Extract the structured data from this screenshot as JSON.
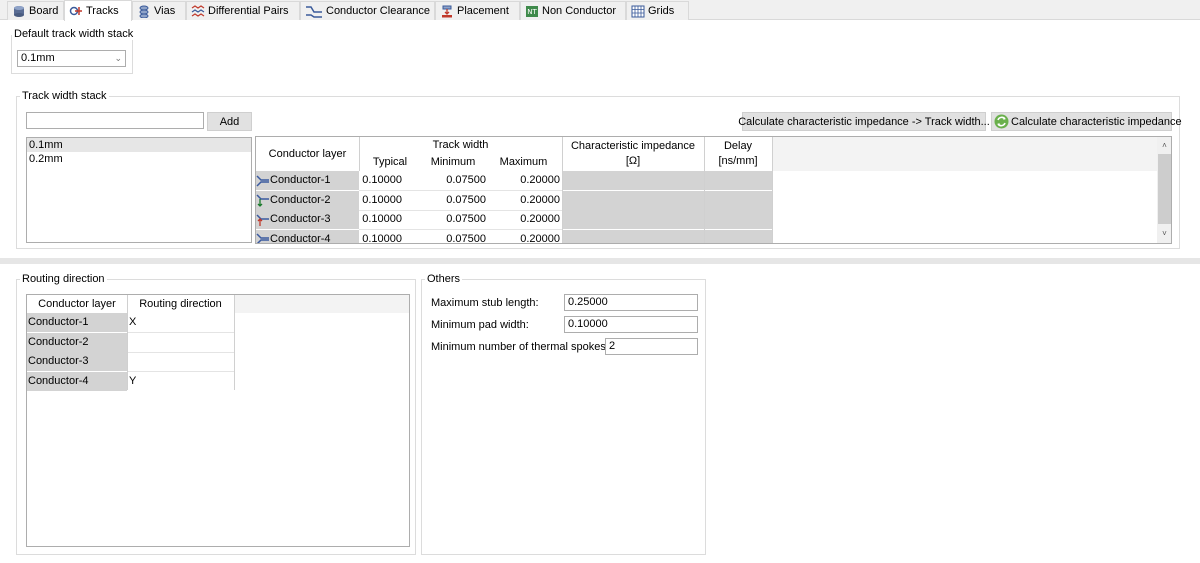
{
  "tabs": [
    {
      "label": "Board",
      "icon": "board-icon"
    },
    {
      "label": "Tracks",
      "icon": "tracks-icon",
      "active": true
    },
    {
      "label": "Vias",
      "icon": "vias-icon"
    },
    {
      "label": "Differential Pairs",
      "icon": "differential-pairs-icon"
    },
    {
      "label": "Conductor Clearance",
      "icon": "conductor-clearance-icon"
    },
    {
      "label": "Placement",
      "icon": "placement-icon"
    },
    {
      "label": "Non Conductor",
      "icon": "non-conductor-icon"
    },
    {
      "label": "Grids",
      "icon": "grids-icon"
    }
  ],
  "default_stack": {
    "title": "Default track width stack",
    "selected": "0.1mm"
  },
  "track_stack": {
    "title": "Track width stack",
    "input_value": "",
    "add_label": "Add",
    "items": [
      "0.1mm",
      "0.2mm"
    ],
    "calc_track_width_label": "Calculate characteristic impedance -> Track width...",
    "calc_impedance_label": "Calculate characteristic impedance",
    "headers": {
      "conductor_layer": "Conductor layer",
      "track_width": "Track width",
      "typical": "Typical",
      "minimum": "Minimum",
      "maximum": "Maximum",
      "impedance": "Characteristic impedance",
      "impedance_unit": "[Ω]",
      "delay": "Delay",
      "delay_unit": "[ns/mm]"
    },
    "rows": [
      {
        "layer": "Conductor-1",
        "typical": "0.10000",
        "minimum": "0.07500",
        "maximum": "0.20000"
      },
      {
        "layer": "Conductor-2",
        "typical": "0.10000",
        "minimum": "0.07500",
        "maximum": "0.20000"
      },
      {
        "layer": "Conductor-3",
        "typical": "0.10000",
        "minimum": "0.07500",
        "maximum": "0.20000"
      },
      {
        "layer": "Conductor-4",
        "typical": "0.10000",
        "minimum": "0.07500",
        "maximum": "0.20000"
      }
    ]
  },
  "routing": {
    "title": "Routing direction",
    "headers": {
      "conductor_layer": "Conductor layer",
      "routing_direction": "Routing direction"
    },
    "rows": [
      {
        "layer": "Conductor-1",
        "direction": "X"
      },
      {
        "layer": "Conductor-2",
        "direction": ""
      },
      {
        "layer": "Conductor-3",
        "direction": ""
      },
      {
        "layer": "Conductor-4",
        "direction": "Y"
      }
    ]
  },
  "others": {
    "title": "Others",
    "max_stub_label": "Maximum stub length:",
    "max_stub_value": "0.25000",
    "min_pad_label": "Minimum pad width:",
    "min_pad_value": "0.10000",
    "min_spokes_label": "Minimum number of thermal spokes:",
    "min_spokes_value": "2"
  }
}
